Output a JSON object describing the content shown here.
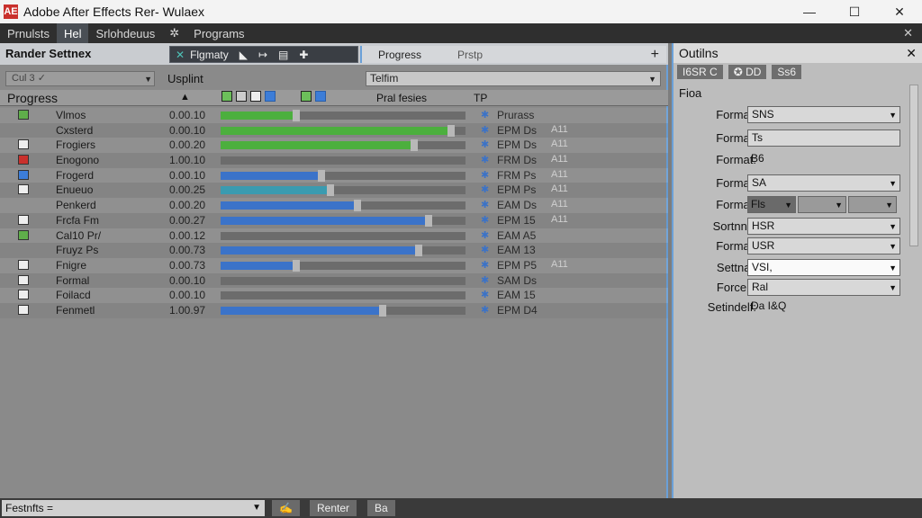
{
  "window": {
    "title": "Adobe After Effects Rer- Wulaex",
    "app_icon": "AE",
    "minimize": "—",
    "maximize": "☐",
    "close": "✕"
  },
  "menu": {
    "items": [
      "Prnulsts",
      "Hel",
      "Srlohdeuus",
      "✲",
      "Programs"
    ],
    "active_index": 1,
    "close": "✕"
  },
  "render_panel": {
    "title": "Rander Settnex",
    "toolbar": {
      "icon": "✕",
      "label": "Flgmaty",
      "symbols": [
        "◣",
        "↦",
        "▤",
        "✚"
      ]
    },
    "progress_tab": {
      "label": "Progress",
      "status": "Prstp",
      "add": "+"
    },
    "dropdown_small": "Cul 3 ✓",
    "usplint": "Usplint",
    "telfim": "Telfim",
    "columns": {
      "progress": "Progress",
      "sort": "▲",
      "pral": "Pral fesies",
      "tp": "TP"
    },
    "rows": [
      {
        "icon": "check",
        "color": "green",
        "name": "Vlmos",
        "time": "0.00.10",
        "value": 0.31,
        "bar": "green",
        "status": "Prurass",
        "ext": ""
      },
      {
        "icon": "",
        "color": "",
        "name": "Cxsterd",
        "time": "0.00.10",
        "value": 0.94,
        "bar": "green",
        "status": "EPM Ds",
        "ext": "A11"
      },
      {
        "icon": "check",
        "color": "white",
        "name": "Frogiers",
        "time": "0.00.20",
        "value": 0.79,
        "bar": "green",
        "status": "EPM Ds",
        "ext": "A11"
      },
      {
        "icon": "flag",
        "color": "red",
        "name": "Enogono",
        "time": "1.00.10",
        "value": 0.0,
        "bar": "none",
        "status": "FRM Ds",
        "ext": "A11"
      },
      {
        "icon": "flag",
        "color": "blue",
        "name": "Frogerd",
        "time": "0.00.10",
        "value": 0.41,
        "bar": "blue",
        "status": "FRM Ps",
        "ext": "A11"
      },
      {
        "icon": "box",
        "color": "white",
        "name": "Enueuo",
        "time": "0.00.25",
        "value": 0.45,
        "bar": "teal",
        "status": "EPM Ps",
        "ext": "A11"
      },
      {
        "icon": "",
        "color": "",
        "name": "Penkerd",
        "time": "0.00.20",
        "value": 0.56,
        "bar": "blue",
        "status": "EAM Ds",
        "ext": "A11"
      },
      {
        "icon": "flag",
        "color": "white",
        "name": "Frcfa Fm",
        "time": "0.00.27",
        "value": 0.85,
        "bar": "blue",
        "status": "EPM 15",
        "ext": "A11"
      },
      {
        "icon": "flag",
        "color": "green",
        "name": "Cal10 Pr/",
        "time": "0.00.12",
        "value": 0.0,
        "bar": "none",
        "status": "EAM A5",
        "ext": ""
      },
      {
        "icon": "",
        "color": "",
        "name": "Fruyz Ps",
        "time": "0.00.73",
        "value": 0.81,
        "bar": "blue",
        "status": "EAM 13",
        "ext": ""
      },
      {
        "icon": "flag",
        "color": "white",
        "name": "Fnigre",
        "time": "0.00.73",
        "value": 0.31,
        "bar": "blue",
        "status": "EPM P5",
        "ext": "A11"
      },
      {
        "icon": "box",
        "color": "white",
        "name": "Formal",
        "time": "0.00.10",
        "value": 0.0,
        "bar": "none",
        "status": "SAM Ds",
        "ext": ""
      },
      {
        "icon": "box",
        "color": "white",
        "name": "Foilacd",
        "time": "0.00.10",
        "value": 0.0,
        "bar": "none",
        "status": "EAM 15",
        "ext": ""
      },
      {
        "icon": "box",
        "color": "white",
        "name": "Fenmetl",
        "time": "1.00.97",
        "value": 0.66,
        "bar": "blue",
        "status": "EPM D4",
        "ext": ""
      }
    ]
  },
  "outputs_panel": {
    "title": "Outilns",
    "close": "✕",
    "tabs": [
      "I6SR C",
      "✪ DD",
      "Ss6"
    ],
    "section": "Fioa",
    "fields": [
      {
        "label": "Format:",
        "value": "SNS",
        "kind": "dropdown"
      },
      {
        "label": "Format:",
        "value": "Ts",
        "kind": "text"
      },
      {
        "label": "Format:",
        "value": "B6",
        "kind": "plain"
      },
      {
        "label": "Format:",
        "value": "SA",
        "kind": "dropdown"
      },
      {
        "label": "Format:",
        "value": "Fls",
        "kind": "split"
      },
      {
        "label": "Sortnny:",
        "value": "HSR",
        "kind": "dropdown"
      },
      {
        "label": "Format:",
        "value": "USR",
        "kind": "dropdown"
      },
      {
        "label": "Settnaj:",
        "value": "VSI,",
        "kind": "dropdown-white"
      },
      {
        "label": "Forcen:",
        "value": "Ral",
        "kind": "dropdown"
      },
      {
        "label": "Setindelf:",
        "value": "Da I&Q",
        "kind": "plain"
      }
    ]
  },
  "statusbar": {
    "field": "Festnfts",
    "field_suffix": "=",
    "buttons": [
      "✍",
      "Renter",
      "Ba"
    ]
  },
  "colors": {
    "accent": "#6aa0d8",
    "bar_green": "#4caf3e",
    "bar_blue": "#3b73c9",
    "bar_teal": "#3a9bb0"
  }
}
